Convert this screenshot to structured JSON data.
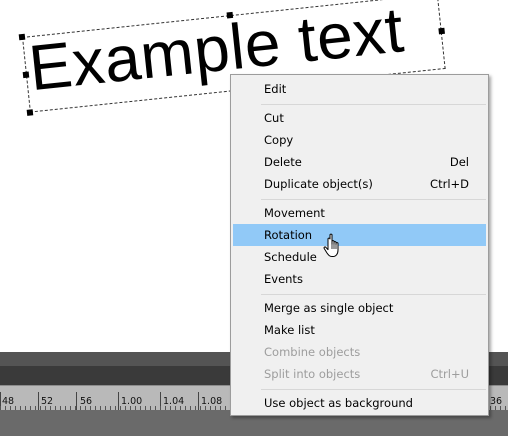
{
  "canvas": {
    "object_text": "Example text"
  },
  "context_menu": {
    "items": [
      {
        "label": "Edit",
        "shortcut": "",
        "enabled": true
      },
      {
        "label": "Cut",
        "shortcut": "",
        "enabled": true
      },
      {
        "label": "Copy",
        "shortcut": "",
        "enabled": true
      },
      {
        "label": "Delete",
        "shortcut": "Del",
        "enabled": true
      },
      {
        "label": "Duplicate object(s)",
        "shortcut": "Ctrl+D",
        "enabled": true
      },
      {
        "label": "Movement",
        "shortcut": "",
        "enabled": true
      },
      {
        "label": "Rotation",
        "shortcut": "",
        "enabled": true,
        "highlighted": true
      },
      {
        "label": "Schedule",
        "shortcut": "",
        "enabled": true
      },
      {
        "label": "Events",
        "shortcut": "",
        "enabled": true
      },
      {
        "label": "Merge as single object",
        "shortcut": "",
        "enabled": true
      },
      {
        "label": "Make list",
        "shortcut": "",
        "enabled": true
      },
      {
        "label": "Combine objects",
        "shortcut": "",
        "enabled": false
      },
      {
        "label": "Split into objects",
        "shortcut": "Ctrl+U",
        "enabled": false
      },
      {
        "label": "Use object as background",
        "shortcut": "",
        "enabled": true
      }
    ]
  },
  "timeline": {
    "ruler_labels": [
      "48",
      "52",
      "56",
      "1.00",
      "1.04",
      "1.08",
      "36"
    ]
  },
  "colors": {
    "highlight": "#91c9f7",
    "menu_background": "#f0f0f0",
    "disabled_text": "#9d9d9d",
    "timeline_background": "#3a3a3a"
  }
}
